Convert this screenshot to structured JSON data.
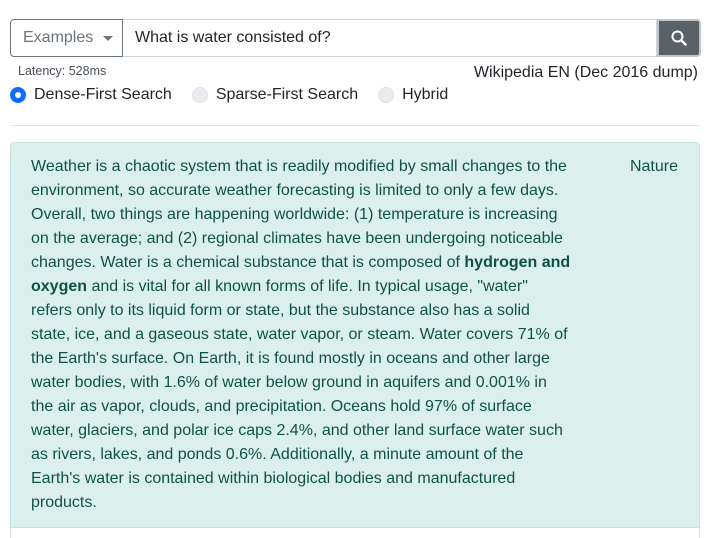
{
  "search": {
    "examples_label": "Examples",
    "query_value": "What is water consisted of?"
  },
  "status": {
    "latency": "Latency: 528ms",
    "source": "Wikipedia EN (Dec 2016 dump)"
  },
  "modes": [
    {
      "label": "Dense-First Search",
      "checked": true
    },
    {
      "label": "Sparse-First Search",
      "checked": false
    },
    {
      "label": "Hybrid",
      "checked": false
    }
  ],
  "result": {
    "topic": "Nature",
    "text_before": "Weather is a chaotic system that is readily modified by small changes to the environment, so accurate weather forecasting is limited to only a few days. Overall, two things are happening worldwide: (1) temperature is increasing on the average; and (2) regional climates have been undergoing noticeable changes. Water is a chemical substance that is composed of ",
    "highlight": "hydrogen and oxygen",
    "text_after": " and is vital for all known forms of life. In typical usage, \"water\" refers only to its liquid form or state, but the substance also has a solid state, ice, and a gaseous state, water vapor, or steam. Water covers 71% of the Earth's surface. On Earth, it is found mostly in oceans and other large water bodies, with 1.6% of water below ground in aquifers and 0.001% in the air as vapor, clouds, and precipitation. Oceans hold 97% of surface water, glaciers, and polar ice caps 2.4%, and other land surface water such as rivers, lakes, and ponds 0.6%. Additionally, a minute amount of the Earth's water is contained within biological bodies and manufactured products."
  },
  "colors": {
    "accent": "#0d6efd",
    "result_bg": "#dbf0ed",
    "result_text": "#0f5147",
    "search_button": "#5a6268"
  }
}
